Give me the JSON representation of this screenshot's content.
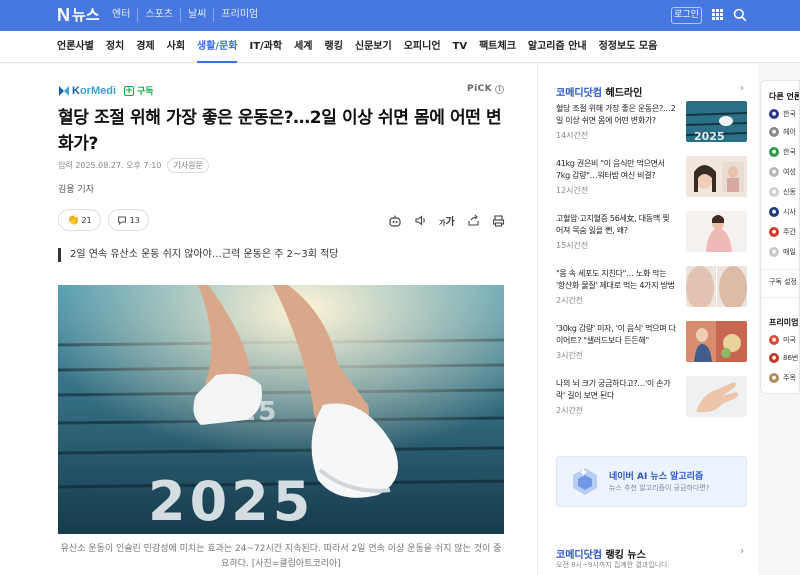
{
  "topbar": {
    "logo_n": "N",
    "logo_news": "뉴스",
    "nav": [
      "엔터",
      "스포츠",
      "날씨",
      "프리미엄"
    ],
    "login": "로그인"
  },
  "categories": [
    "언론사별",
    "정치",
    "경제",
    "사회",
    "생활/문화",
    "IT/과학",
    "세계",
    "랭킹",
    "신문보기",
    "오피니언",
    "TV",
    "팩트체크",
    "알고리즘 안내",
    "정정보도 모음"
  ],
  "active_category": "생활/문화",
  "article": {
    "press_name_a": "K",
    "press_name_b": "orMedi",
    "subscribe": "구독",
    "pick": "PiCK",
    "headline": "혈당 조절 위해 가장 좋은 운동은?…2일 이상 쉬면 몸에 어떤 변화가?",
    "meta_date": "입력 2025.08.27. 오후 7:10",
    "meta_original": "기사원문",
    "reporter": "김용 기자",
    "reaction_count": "21",
    "comment_count": "13",
    "font_label": "가",
    "summary": "2일 연속 유산소 운동 쉬지 않아야…근력 운동은 주 2~3회 적당",
    "photo_text": "2025",
    "caption": "유산소 운동이 인슐린 민감성에 미치는 효과는 24~72시간 지속된다. 따라서 2일 연속 이상 운동을 쉬지 않는 것이 중요하다. [사진=클립아트코리아]"
  },
  "sidebar": {
    "headline_brand": "코메디닷컴",
    "headline_title": "헤드라인",
    "items": [
      {
        "text": "혈당 조절 위해 가장 좋은 운동은?…2일 이상 쉬면 몸에 어떤 변화가?",
        "time": "14시간전"
      },
      {
        "text": "41kg 권은비 \"이 음식만 먹으면서 7kg 감량\"…워터밤 여신 비결?",
        "time": "12시간전"
      },
      {
        "text": "고혈압·고지혈증 56세女, 대동맥 찢어져 목숨 잃을 뻔, 왜?",
        "time": "15시간전"
      },
      {
        "text": "\"몸 속 세포도 지친다\"… 노화 막는 '항산화 물질' 제대로 먹는 4가지 방법",
        "time": "2시간전"
      },
      {
        "text": "'30kg 감량' 미자, '이 음식' 먹으며 다이어트? \"샐러드보다 든든해\"",
        "time": "3시간전"
      },
      {
        "text": "나의 뇌 크기 궁금하다고?…'이 손가락' 길이 보면 된다",
        "time": "2시간전"
      }
    ],
    "ai_title": "네이버 AI 뉴스 알고리즘",
    "ai_sub": "뉴스 추천 알고리즘이 궁금하다면?",
    "ranking_brand": "코메디닷컴",
    "ranking_title": "랭킹 뉴스",
    "ranking_sub": "오전 8시~9시까지 집계한 결과입니다."
  },
  "far_right": {
    "title": "다른 언론사",
    "press": [
      "한국",
      "헤이",
      "한국",
      "여성",
      "신동",
      "시사",
      "주간",
      "매일"
    ],
    "subscribe_settings": "구독 설정",
    "premium_title": "프리미엄",
    "premium_items": [
      "미국",
      "86번",
      "주목"
    ]
  },
  "colors": {
    "brand": "#4777e0",
    "accent": "#3c6fe0",
    "subscribe_green": "#0cad4b"
  }
}
